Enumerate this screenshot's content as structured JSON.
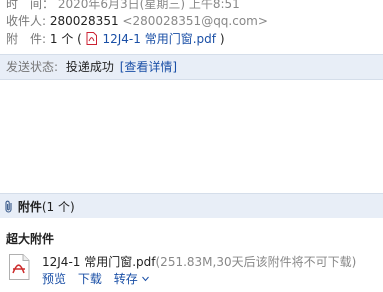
{
  "header": {
    "time_label": "时　间：",
    "time_value": "2020年6月3日(星期三) 上午8:51",
    "to_label": "收件人:",
    "to_name": "280028351",
    "to_email": "<280028351@qq.com>",
    "attach_label": "附　件:",
    "attach_count": "1 个 (",
    "attach_file": "12J4-1 常用门窗.pdf",
    "attach_close": ")"
  },
  "status": {
    "label": "发送状态:",
    "value": "投递成功",
    "detail_link": "[查看详情]"
  },
  "attachments": {
    "title": "附件",
    "count": "(1 个)",
    "section_title": "超大附件",
    "file_name": "12J4-1 常用门窗.pdf",
    "file_meta": "(251.83M,30天后该附件将不可下载)",
    "actions": {
      "preview": "预览",
      "download": "下载",
      "forward": "转存"
    }
  },
  "colors": {
    "status_bar_bg": "#e8eef7",
    "link": "#1a4fa6"
  },
  "icons": [
    "pdf-icon",
    "paperclip-icon",
    "chevron-down-icon"
  ]
}
